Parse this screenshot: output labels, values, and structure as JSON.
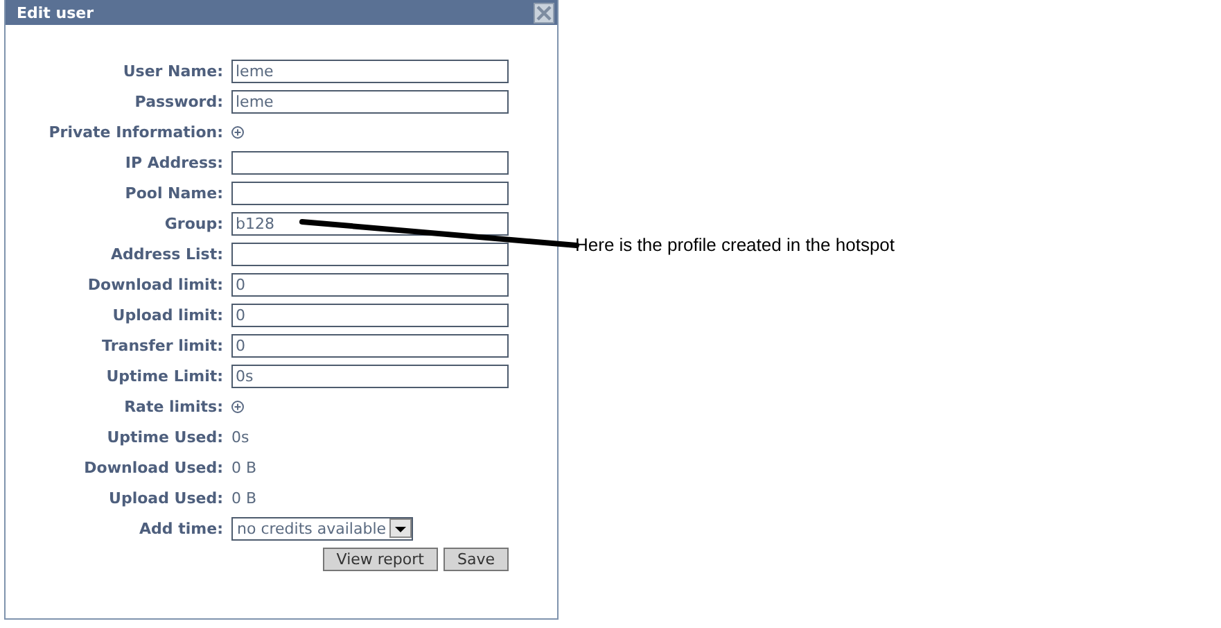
{
  "dialog": {
    "title": "Edit user",
    "rows": [
      {
        "kind": "field",
        "label": "User Name:",
        "value": "leme"
      },
      {
        "kind": "field",
        "label": "Password:",
        "value": "leme"
      },
      {
        "kind": "expand",
        "label": "Private Information:",
        "expanded": false
      },
      {
        "kind": "field",
        "label": "IP Address:",
        "value": ""
      },
      {
        "kind": "field",
        "label": "Pool Name:",
        "value": ""
      },
      {
        "kind": "field",
        "label": "Group:",
        "value": "b128"
      },
      {
        "kind": "field",
        "label": "Address List:",
        "value": ""
      },
      {
        "kind": "field",
        "label": "Download limit:",
        "value": "0"
      },
      {
        "kind": "field",
        "label": "Upload limit:",
        "value": "0"
      },
      {
        "kind": "field",
        "label": "Transfer limit:",
        "value": "0"
      },
      {
        "kind": "field",
        "label": "Uptime Limit:",
        "value": "0s"
      },
      {
        "kind": "expand",
        "label": "Rate limits:",
        "expanded": false
      },
      {
        "kind": "text",
        "label": "Uptime Used:",
        "value": "0s"
      },
      {
        "kind": "text",
        "label": "Download Used:",
        "value": "0 B"
      },
      {
        "kind": "text",
        "label": "Upload Used:",
        "value": "0 B"
      },
      {
        "kind": "select",
        "label": "Add time:",
        "value": "no credits available"
      }
    ],
    "buttons": [
      "View report",
      "Save"
    ]
  },
  "annotation": {
    "text": "Here is the profile created in the hotspot"
  }
}
